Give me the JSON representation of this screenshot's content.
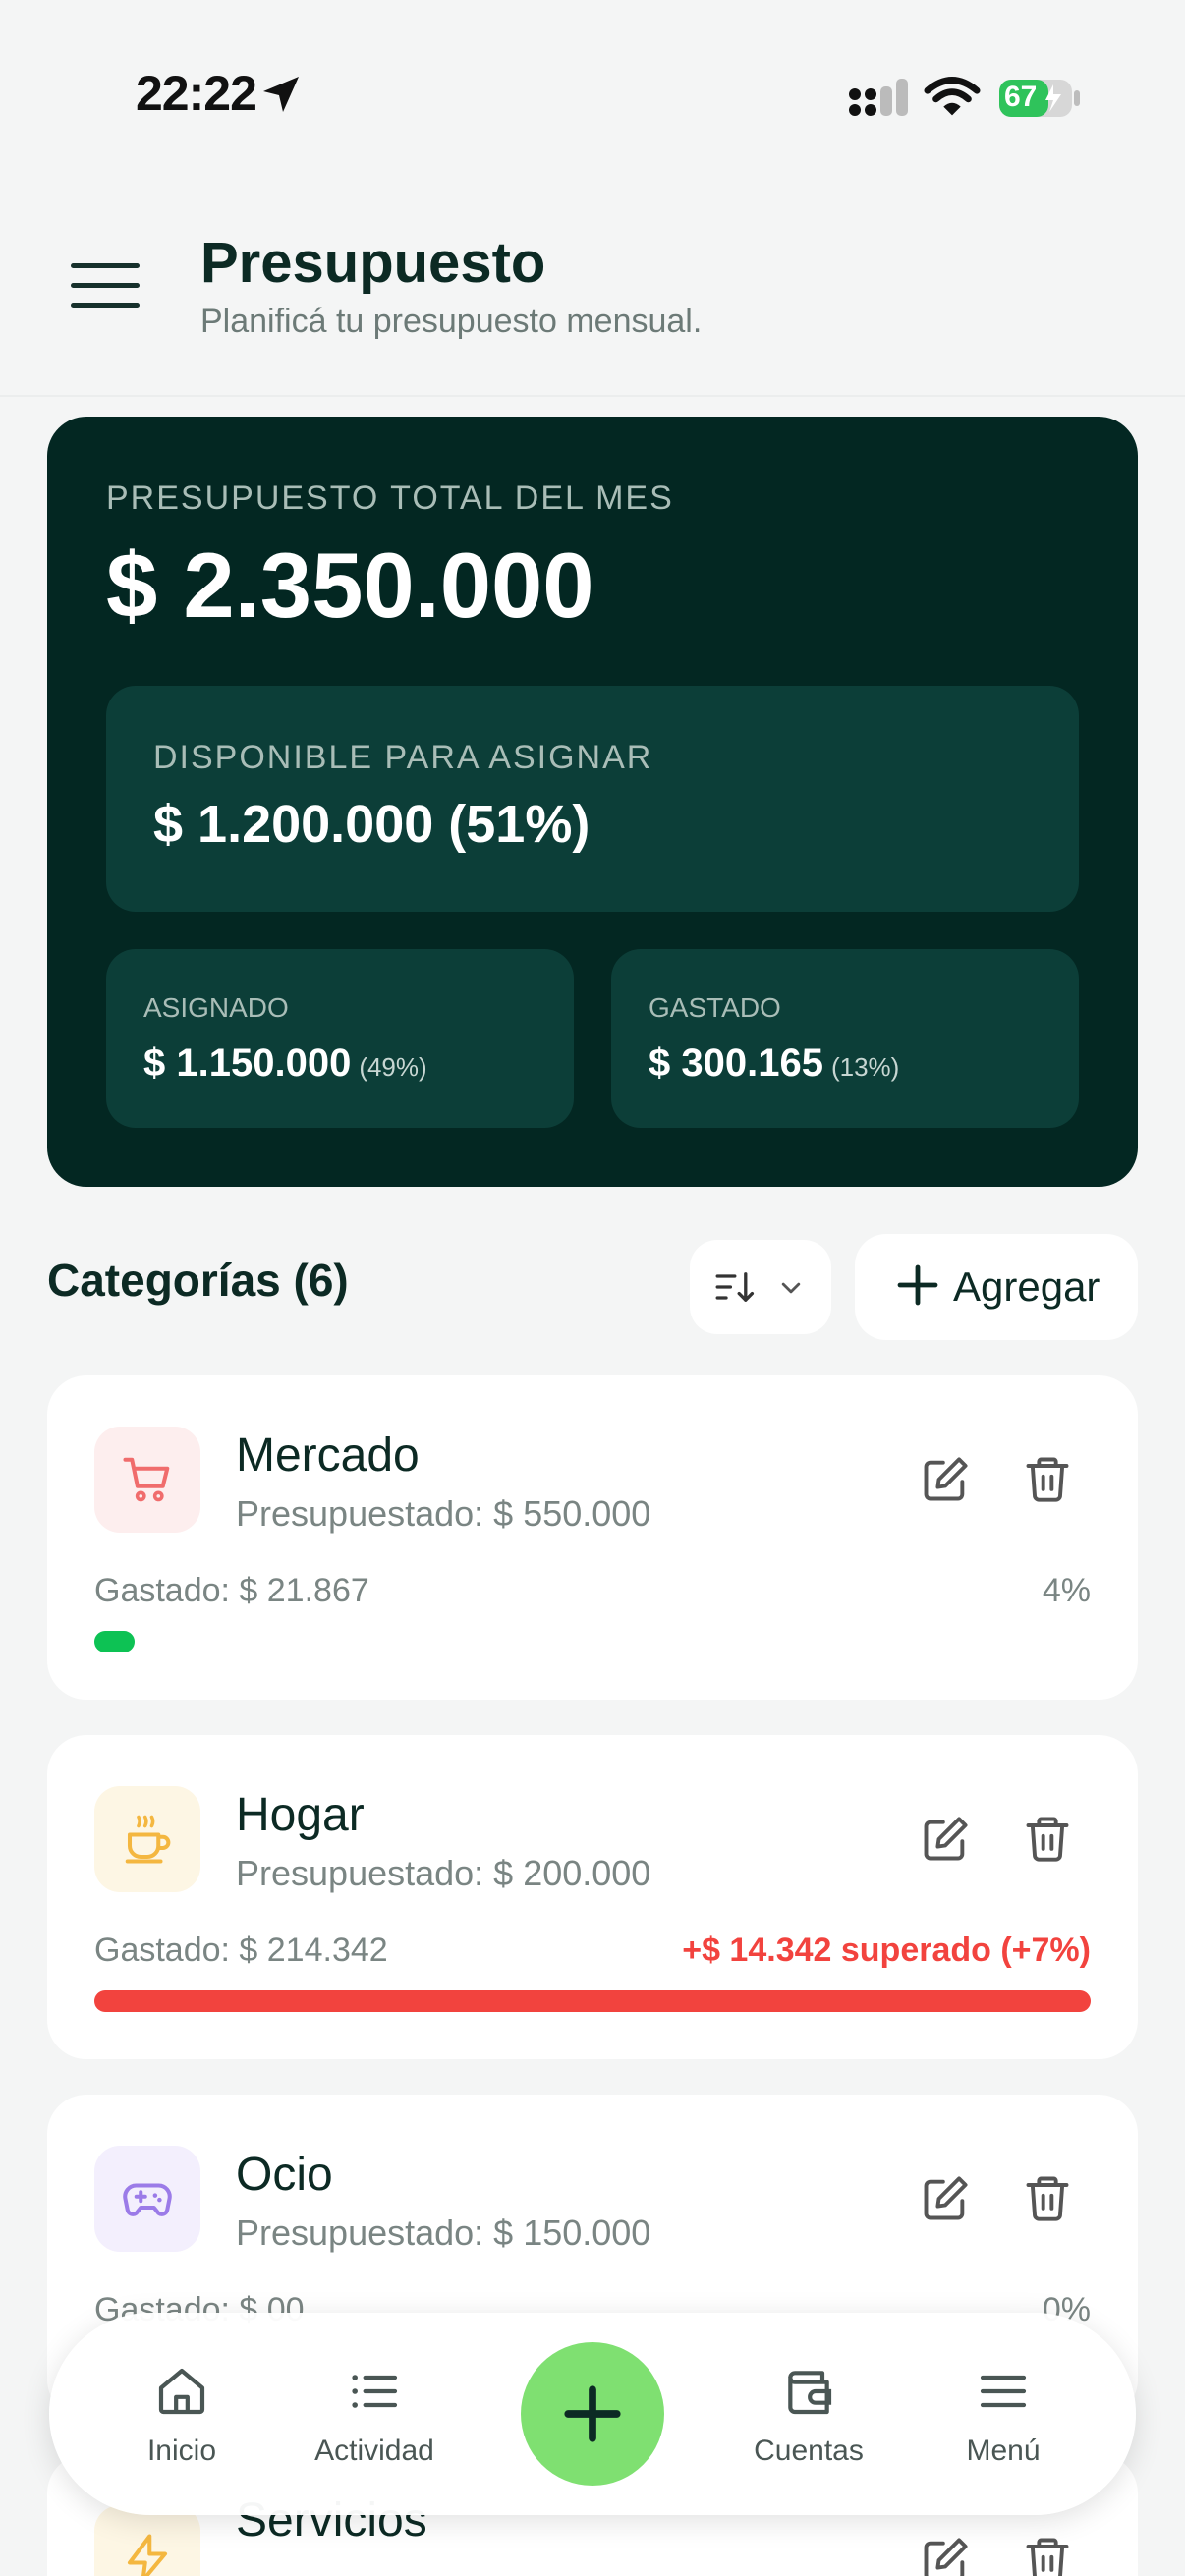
{
  "status_bar": {
    "time": "22:22",
    "battery": "67"
  },
  "header": {
    "title": "Presupuesto",
    "subtitle": "Planificá tu presupuesto mensual."
  },
  "summary": {
    "total_label": "PRESUPUESTO TOTAL DEL MES",
    "total_value": "$ 2.350.000",
    "available_label": "DISPONIBLE PARA ASIGNAR",
    "available_value": "$ 1.200.000 (51%)",
    "assigned_label": "ASIGNADO",
    "assigned_value": "$ 1.150.000",
    "assigned_pct": "(49%)",
    "spent_label": "GASTADO",
    "spent_value": "$ 300.165",
    "spent_pct": "(13%)"
  },
  "categories": {
    "title": "Categorías (6)",
    "add_label": "Agregar",
    "items": [
      {
        "name": "Mercado",
        "budget": "Presupuestado: $ 550.000",
        "spent": "Gastado: $ 21.867",
        "status": "4%",
        "progress": 0.04,
        "icon": "cart-icon",
        "color": "#0dc254"
      },
      {
        "name": "Hogar",
        "budget": "Presupuestado: $ 200.000",
        "spent": "Gastado: $ 214.342",
        "status": "+$ 14.342 superado (+7%)",
        "progress": 1.0,
        "icon": "cup-icon",
        "color": "#f2433e"
      },
      {
        "name": "Ocio",
        "budget": "Presupuestado: $ 150.000",
        "spent": "Gastado: $ 00",
        "status": "0%",
        "progress": 0.0,
        "icon": "gamepad-icon",
        "color": "#0dc254"
      },
      {
        "name": "Servicios",
        "icon": "bolt-icon"
      }
    ]
  },
  "nav": {
    "home": "Inicio",
    "activity": "Actividad",
    "accounts": "Cuentas",
    "menu": "Menú"
  },
  "colors": {
    "accent": "#7fe071",
    "dark_card": "#032722",
    "inner_card": "#0c3e38",
    "over_budget": "#f2433e",
    "progress_ok": "#0dc254"
  }
}
